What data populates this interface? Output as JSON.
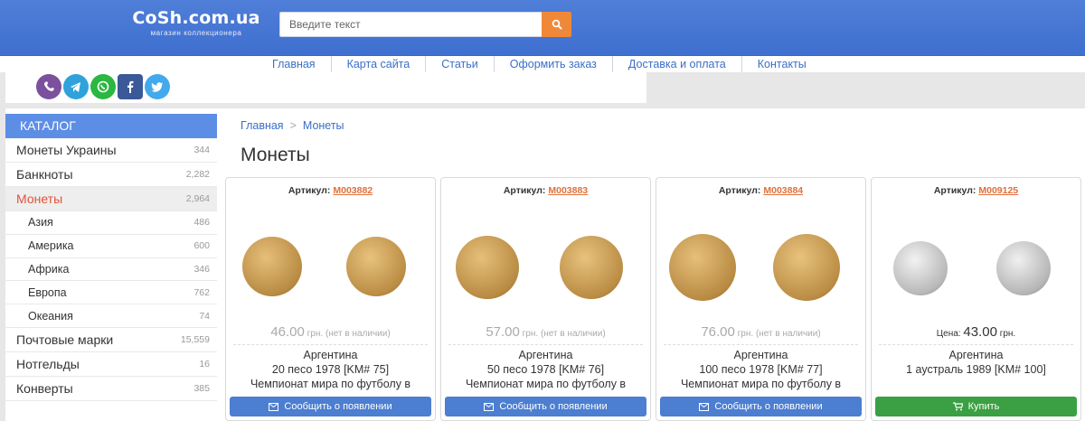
{
  "logo": {
    "title": "CoSh.com.ua",
    "subtitle": "магазин коллекционера"
  },
  "search": {
    "placeholder": "Введите текст"
  },
  "nav": [
    "Главная",
    "Карта сайта",
    "Статьи",
    "Оформить заказ",
    "Доставка и оплата",
    "Контакты"
  ],
  "social": [
    {
      "icon": "viber-icon",
      "color": "#7b519d"
    },
    {
      "icon": "telegram-icon",
      "color": "#2fa2db"
    },
    {
      "icon": "whatsapp-icon",
      "color": "#2bb741"
    },
    {
      "icon": "facebook-icon",
      "color": "#3b5998"
    },
    {
      "icon": "twitter-icon",
      "color": "#42aaec"
    }
  ],
  "sidebar": {
    "header": "КАТАЛОГ",
    "items": [
      {
        "label": "Монеты Украины",
        "count": "344"
      },
      {
        "label": "Банкноты",
        "count": "2,282"
      },
      {
        "label": "Монеты",
        "count": "2,964",
        "active": true
      },
      {
        "label": "Азия",
        "count": "486",
        "sub": true
      },
      {
        "label": "Америка",
        "count": "600",
        "sub": true
      },
      {
        "label": "Африка",
        "count": "346",
        "sub": true
      },
      {
        "label": "Европа",
        "count": "762",
        "sub": true
      },
      {
        "label": "Океания",
        "count": "74",
        "sub": true
      },
      {
        "label": "Почтовые марки",
        "count": "15,559"
      },
      {
        "label": "Нотгельды",
        "count": "16"
      },
      {
        "label": "Конверты",
        "count": "385"
      }
    ]
  },
  "breadcrumb": {
    "home": "Главная",
    "sep": ">",
    "current": "Монеты"
  },
  "page_title": "Монеты",
  "products": [
    {
      "article_label": "Артикул:",
      "article": "M003882",
      "price_prefix": "",
      "price": "46.00",
      "currency": "грн.",
      "status": "(нет в наличии)",
      "country": "Аргентина",
      "name": "20 песо 1978 [KM# 75]",
      "desc": "Чемпионат мира по футболу в",
      "button": "Сообщить о появлении",
      "available": false,
      "metal": "brass"
    },
    {
      "article_label": "Артикул:",
      "article": "M003883",
      "price_prefix": "",
      "price": "57.00",
      "currency": "грн.",
      "status": "(нет в наличии)",
      "country": "Аргентина",
      "name": "50 песо 1978 [KM# 76]",
      "desc": "Чемпионат мира по футболу в",
      "button": "Сообщить о появлении",
      "available": false,
      "metal": "brass"
    },
    {
      "article_label": "Артикул:",
      "article": "M003884",
      "price_prefix": "",
      "price": "76.00",
      "currency": "грн.",
      "status": "(нет в наличии)",
      "country": "Аргентина",
      "name": "100 песо 1978 [KM# 77]",
      "desc": "Чемпионат мира по футболу в",
      "button": "Сообщить о появлении",
      "available": false,
      "metal": "brass"
    },
    {
      "article_label": "Артикул:",
      "article": "M009125",
      "price_prefix": "Цена:",
      "price": "43.00",
      "currency": "грн.",
      "status": "",
      "country": "Аргентина",
      "name": "1 аустраль 1989 [KM# 100]",
      "desc": "",
      "button": "Купить",
      "available": true,
      "metal": "steel"
    }
  ]
}
